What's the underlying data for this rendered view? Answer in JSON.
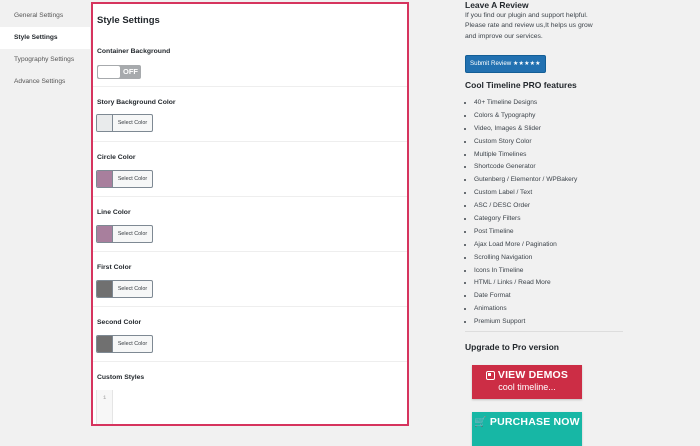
{
  "nav": {
    "items": [
      {
        "label": "General Settings",
        "active": false
      },
      {
        "label": "Style Settings",
        "active": true
      },
      {
        "label": "Typography Settings",
        "active": false
      },
      {
        "label": "Advance Settings",
        "active": false
      }
    ]
  },
  "panel": {
    "title": "Style Settings",
    "container_background": {
      "label": "Container Background",
      "toggle_text": "OFF"
    },
    "color_button_label": "Select Color",
    "fields": [
      {
        "label": "Story Background Color",
        "swatch": "#e9ebec"
      },
      {
        "label": "Circle Color",
        "swatch": "#a87f9d"
      },
      {
        "label": "Line Color",
        "swatch": "#a87f9d"
      },
      {
        "label": "First Color",
        "swatch": "#707070"
      },
      {
        "label": "Second Color",
        "swatch": "#707070"
      }
    ],
    "custom_styles": {
      "label": "Custom Styles",
      "line_number": "1"
    }
  },
  "sidebar": {
    "review": {
      "title": "Leave A Review",
      "text": "If you find our plugin and support helpful. Please rate and review us,It helps us grow and improve our services.",
      "button": "Submit Review ★★★★★"
    },
    "features": {
      "title": "Cool Timeline PRO features",
      "items": [
        "40+ Timeline Designs",
        "Colors & Typography",
        "Video, Images & Slider",
        "Custom Story Color",
        "Multiple Timelines",
        "Shortcode Generator",
        "Gutenberg / Elementor / WPBakery",
        "Custom Label / Text",
        "ASC / DESC Order",
        "Category Filters",
        "Post Timeline",
        "Ajax Load More / Pagination",
        "Scrolling Navigation",
        "Icons In Timeline",
        "HTML / Links / Read More",
        "Date Format",
        "Animations",
        "Premium Support"
      ]
    },
    "upgrade": {
      "title": "Upgrade to Pro version",
      "demo_big": "VIEW DEMOS",
      "demo_small": "cool timeline...",
      "purchase_big": "PURCHASE NOW"
    }
  },
  "colors": {
    "accent": "#d6345e",
    "review_button": "#2271b1",
    "demo_banner": "#cc2d45",
    "purchase_banner": "#17b7a5"
  }
}
